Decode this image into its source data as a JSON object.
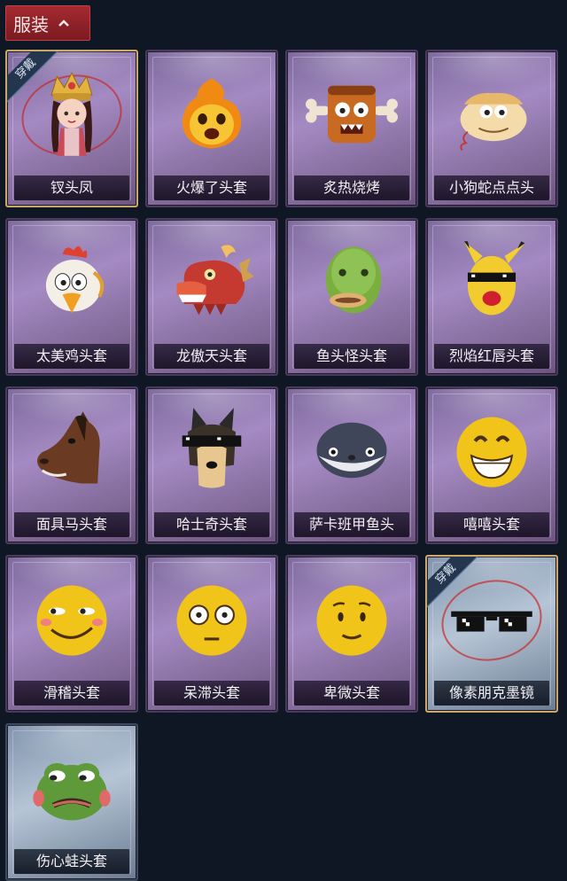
{
  "header": {
    "title": "服装"
  },
  "badge_label": "穿戴",
  "items": [
    {
      "label": "钗头凤",
      "icon": "phoenix-crown-icon",
      "worn": true,
      "frame": "purple"
    },
    {
      "label": "火爆了头套",
      "icon": "fireball-head-icon",
      "worn": false,
      "frame": "purple"
    },
    {
      "label": "炙热烧烤",
      "icon": "bbq-meat-head-icon",
      "worn": false,
      "frame": "purple"
    },
    {
      "label": "小狗蛇点点头",
      "icon": "snake-head-icon",
      "worn": false,
      "frame": "purple"
    },
    {
      "label": "太美鸡头套",
      "icon": "chicken-head-icon",
      "worn": false,
      "frame": "purple"
    },
    {
      "label": "龙傲天头套",
      "icon": "dragon-head-icon",
      "worn": false,
      "frame": "purple"
    },
    {
      "label": "鱼头怪头套",
      "icon": "fish-monster-head-icon",
      "worn": false,
      "frame": "purple"
    },
    {
      "label": "烈焰红唇头套",
      "icon": "pikachu-lips-head-icon",
      "worn": false,
      "frame": "purple"
    },
    {
      "label": "面具马头套",
      "icon": "horse-mask-icon",
      "worn": false,
      "frame": "purple"
    },
    {
      "label": "哈士奇头套",
      "icon": "husky-head-icon",
      "worn": false,
      "frame": "purple"
    },
    {
      "label": "萨卡班甲鱼头",
      "icon": "sacabambaspis-head-icon",
      "worn": false,
      "frame": "purple"
    },
    {
      "label": "嘻嘻头套",
      "icon": "grin-emoji-head-icon",
      "worn": false,
      "frame": "purple"
    },
    {
      "label": "滑稽头套",
      "icon": "funny-emoji-head-icon",
      "worn": false,
      "frame": "purple"
    },
    {
      "label": "呆滞头套",
      "icon": "stunned-emoji-head-icon",
      "worn": false,
      "frame": "purple"
    },
    {
      "label": "卑微头套",
      "icon": "humble-emoji-head-icon",
      "worn": false,
      "frame": "purple"
    },
    {
      "label": "像素朋克墨镜",
      "icon": "pixel-sunglasses-icon",
      "worn": true,
      "frame": "blue"
    },
    {
      "label": "伤心蛙头套",
      "icon": "sad-frog-head-icon",
      "worn": false,
      "frame": "blue"
    }
  ]
}
